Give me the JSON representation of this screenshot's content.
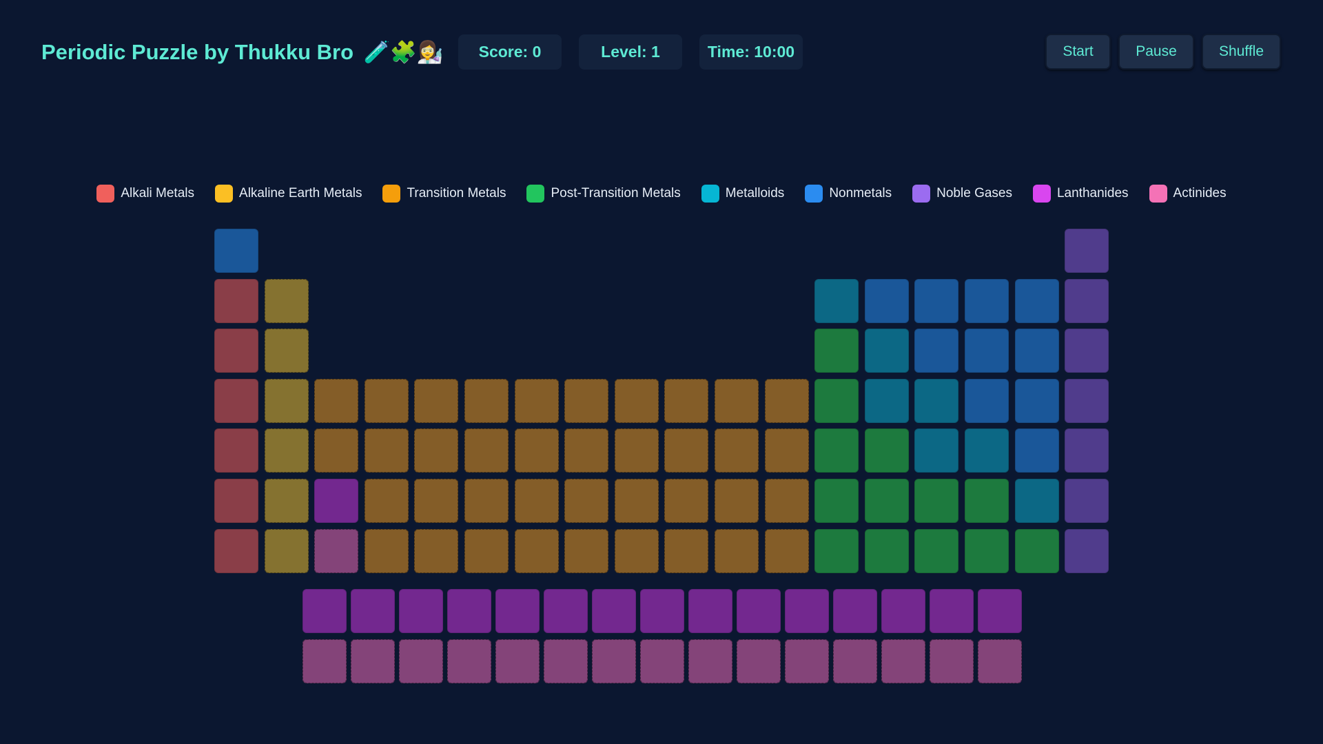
{
  "app": {
    "title": "Periodic Puzzle by Thukku Bro",
    "title_emoji": "🧪🧩👩‍🔬"
  },
  "stats": {
    "score": "Score: 0",
    "level": "Level: 1",
    "time": "Time: 10:00"
  },
  "controls": {
    "start": "Start",
    "pause": "Pause",
    "shuffle": "Shuffle"
  },
  "legend": [
    {
      "key": "alkali",
      "label": "Alkali Metals",
      "color": "#f0605c"
    },
    {
      "key": "alkaline",
      "label": "Alkaline Earth Metals",
      "color": "#fbbf24"
    },
    {
      "key": "transition",
      "label": "Transition Metals",
      "color": "#f59e0b"
    },
    {
      "key": "post",
      "label": "Post-Transition Metals",
      "color": "#22c55e"
    },
    {
      "key": "metalloid",
      "label": "Metalloids",
      "color": "#06b6d4"
    },
    {
      "key": "nonmetal",
      "label": "Nonmetals",
      "color": "#2b8cf0"
    },
    {
      "key": "noble",
      "label": "Noble Gases",
      "color": "#9b6cf0"
    },
    {
      "key": "lanth",
      "label": "Lanthanides",
      "color": "#d946ef"
    },
    {
      "key": "actin",
      "label": "Actinides",
      "color": "#f472b6"
    }
  ],
  "slot_colors": {
    "alkali": "#8a3e48",
    "alkaline": "#857230",
    "transition": "#845d28",
    "post": "#1d7a3e",
    "metalloid": "#0c6885",
    "nonmetal": "#1a5799",
    "noble": "#503c8c",
    "lanth": "#73288f",
    "actin": "#844479"
  },
  "board": {
    "main_rows": [
      [
        "nonmetal",
        null,
        null,
        null,
        null,
        null,
        null,
        null,
        null,
        null,
        null,
        null,
        null,
        null,
        null,
        null,
        null,
        "noble"
      ],
      [
        "alkali",
        "alkaline",
        null,
        null,
        null,
        null,
        null,
        null,
        null,
        null,
        null,
        null,
        "metalloid",
        "nonmetal",
        "nonmetal",
        "nonmetal",
        "nonmetal",
        "noble"
      ],
      [
        "alkali",
        "alkaline",
        null,
        null,
        null,
        null,
        null,
        null,
        null,
        null,
        null,
        null,
        "post",
        "metalloid",
        "nonmetal",
        "nonmetal",
        "nonmetal",
        "noble"
      ],
      [
        "alkali",
        "alkaline",
        "transition",
        "transition",
        "transition",
        "transition",
        "transition",
        "transition",
        "transition",
        "transition",
        "transition",
        "transition",
        "post",
        "metalloid",
        "metalloid",
        "nonmetal",
        "nonmetal",
        "noble"
      ],
      [
        "alkali",
        "alkaline",
        "transition",
        "transition",
        "transition",
        "transition",
        "transition",
        "transition",
        "transition",
        "transition",
        "transition",
        "transition",
        "post",
        "post",
        "metalloid",
        "metalloid",
        "nonmetal",
        "noble"
      ],
      [
        "alkali",
        "alkaline",
        "lanth",
        "transition",
        "transition",
        "transition",
        "transition",
        "transition",
        "transition",
        "transition",
        "transition",
        "transition",
        "post",
        "post",
        "post",
        "post",
        "metalloid",
        "noble"
      ],
      [
        "alkali",
        "alkaline",
        "actin",
        "transition",
        "transition",
        "transition",
        "transition",
        "transition",
        "transition",
        "transition",
        "transition",
        "transition",
        "post",
        "post",
        "post",
        "post",
        "post",
        "noble"
      ]
    ],
    "f_rows": [
      [
        "lanth",
        "lanth",
        "lanth",
        "lanth",
        "lanth",
        "lanth",
        "lanth",
        "lanth",
        "lanth",
        "lanth",
        "lanth",
        "lanth",
        "lanth",
        "lanth",
        "lanth"
      ],
      [
        "actin",
        "actin",
        "actin",
        "actin",
        "actin",
        "actin",
        "actin",
        "actin",
        "actin",
        "actin",
        "actin",
        "actin",
        "actin",
        "actin",
        "actin"
      ]
    ]
  }
}
